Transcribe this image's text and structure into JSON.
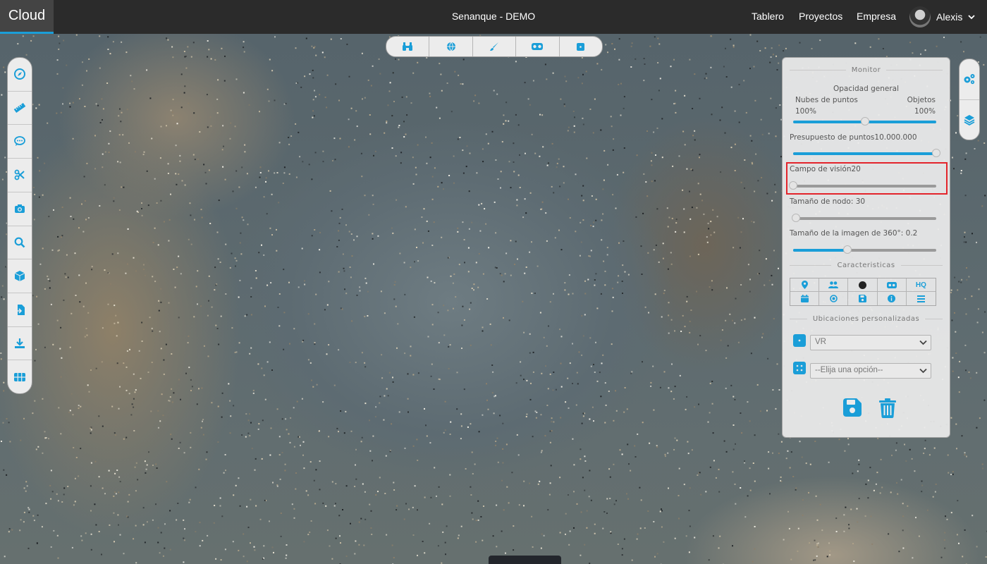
{
  "header": {
    "logo": "Cloud",
    "project_title": "Senanque - DEMO",
    "nav": [
      "Tablero",
      "Proyectos",
      "Empresa"
    ],
    "user_name": "Alexis"
  },
  "top_toolbar": {
    "icons": [
      "binoculars-icon",
      "globe-icon",
      "paint-brush-icon",
      "vr-headset-icon",
      "cube-face-icon"
    ]
  },
  "left_toolbar": {
    "icons": [
      "compass-icon",
      "ruler-icon",
      "comment-icon",
      "scissors-icon",
      "camera-icon",
      "search-icon",
      "cube-icon",
      "file-import-icon",
      "download-icon",
      "grid-icon"
    ]
  },
  "right_toolbar": {
    "icons": [
      "settings-gears-icon",
      "layers-icon"
    ]
  },
  "panel": {
    "monitor_title": "Monitor",
    "opacity_title": "Opacidad general",
    "opacity_left_label": "Nubes de puntos",
    "opacity_right_label": "Objetos",
    "opacity_left_value": "100%",
    "opacity_right_value": "100%",
    "opacity_fraction": 0.5,
    "points_budget_label": "Presupuesto de puntos",
    "points_budget_value": "10.000.000",
    "points_budget_fraction": 1.0,
    "fov_label": "Campo de visión",
    "fov_value": "20",
    "fov_fraction": 0.0,
    "node_size_label": "Tamaño de nodo: 30",
    "node_size_fraction": 0.02,
    "image360_label": "Tamaño de la imagen de 360°: 0.2",
    "image360_fraction": 0.38,
    "features_title": "Caracteristicas",
    "feature_buttons": [
      "map-marker-icon",
      "users-icon",
      "point-dot-icon",
      "vr-headset-icon",
      "HQ",
      "calendar-icon",
      "badge-icon",
      "save-icon",
      "info-icon",
      "list-icon"
    ],
    "feature_hq_text": "HQ",
    "locations_title": "Ubicaciones personalizadas",
    "location_select_1": "VR",
    "location_select_2": "--Elija una opción--",
    "accent_color": "#1a9ed8",
    "highlight_color": "#e3242b"
  }
}
